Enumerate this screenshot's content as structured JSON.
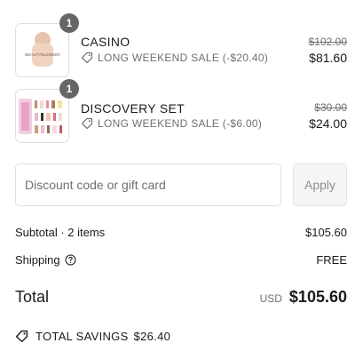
{
  "items": [
    {
      "name": "CASINO",
      "quantity": "1",
      "discount_label": "LONG WEEKEND SALE (-$20.40)",
      "original_price": "$102.00",
      "price": "$81.60",
      "thumb_label": "BEAUTYBLENDER"
    },
    {
      "name": "DISCOVERY SET",
      "quantity": "1",
      "discount_label": "LONG WEEKEND SALE (-$6.00)",
      "original_price": "$30.00",
      "price": "$24.00"
    }
  ],
  "discount": {
    "placeholder": "Discount code or gift card",
    "apply_label": "Apply"
  },
  "summary": {
    "subtotal_label": "Subtotal · 2 items",
    "subtotal_value": "$105.60",
    "shipping_label": "Shipping",
    "shipping_value": "FREE",
    "total_label": "Total",
    "currency": "USD",
    "total_value": "$105.60",
    "savings_label": "TOTAL SAVINGS",
    "savings_value": "$26.40"
  },
  "colors": {
    "text": "#1a1a1a",
    "muted": "#707070",
    "badge": "#666666",
    "border": "#dedede"
  }
}
